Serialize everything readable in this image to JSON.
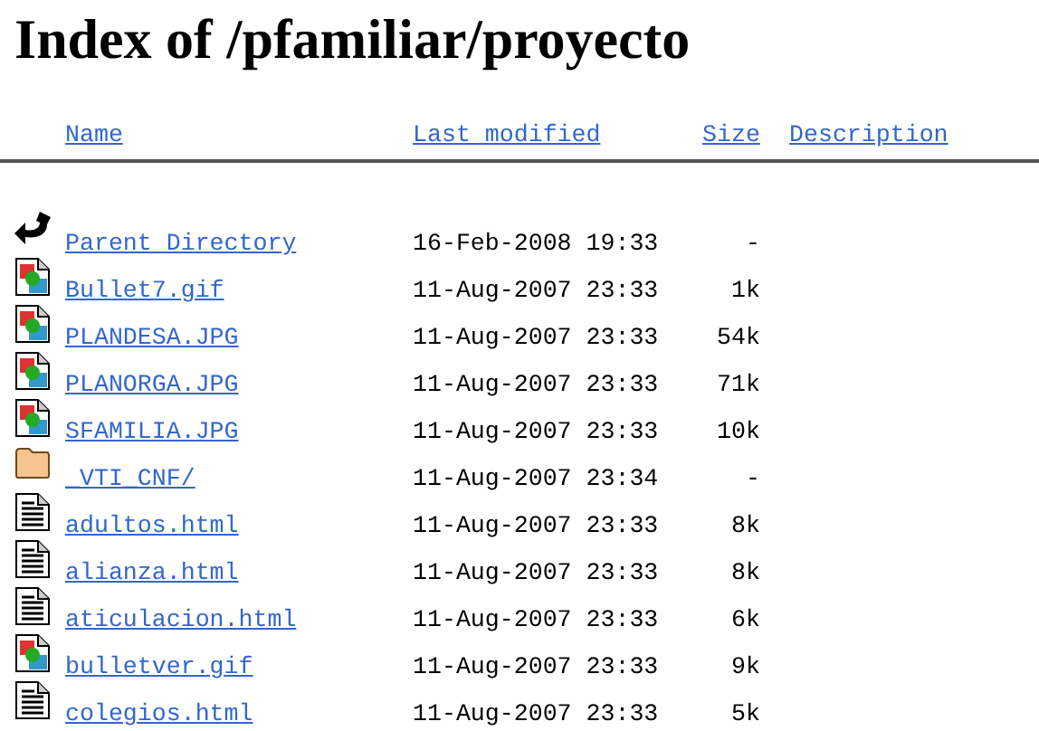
{
  "title": "Index of /pfamiliar/proyecto",
  "columns": [
    "Name",
    "Last modified",
    "Size",
    "Description"
  ],
  "rows": [
    {
      "kind": "back",
      "name": "Parent Directory",
      "modified": "16-Feb-2008 19:33",
      "size": "-"
    },
    {
      "kind": "image",
      "name": "Bullet7.gif",
      "modified": "11-Aug-2007 23:33",
      "size": "1k"
    },
    {
      "kind": "image",
      "name": "PLANDESA.JPG",
      "modified": "11-Aug-2007 23:33",
      "size": "54k"
    },
    {
      "kind": "image",
      "name": "PLANORGA.JPG",
      "modified": "11-Aug-2007 23:33",
      "size": "71k"
    },
    {
      "kind": "image",
      "name": "SFAMILIA.JPG",
      "modified": "11-Aug-2007 23:33",
      "size": "10k"
    },
    {
      "kind": "folder",
      "name": "_VTI_CNF/",
      "modified": "11-Aug-2007 23:34",
      "size": "-"
    },
    {
      "kind": "text",
      "name": "adultos.html",
      "modified": "11-Aug-2007 23:33",
      "size": "8k"
    },
    {
      "kind": "text",
      "name": "alianza.html",
      "modified": "11-Aug-2007 23:33",
      "size": "8k"
    },
    {
      "kind": "text",
      "name": "aticulacion.html",
      "modified": "11-Aug-2007 23:33",
      "size": "6k"
    },
    {
      "kind": "image",
      "name": "bulletver.gif",
      "modified": "11-Aug-2007 23:33",
      "size": "9k"
    },
    {
      "kind": "text",
      "name": "colegios.html",
      "modified": "11-Aug-2007 23:33",
      "size": "5k"
    }
  ]
}
